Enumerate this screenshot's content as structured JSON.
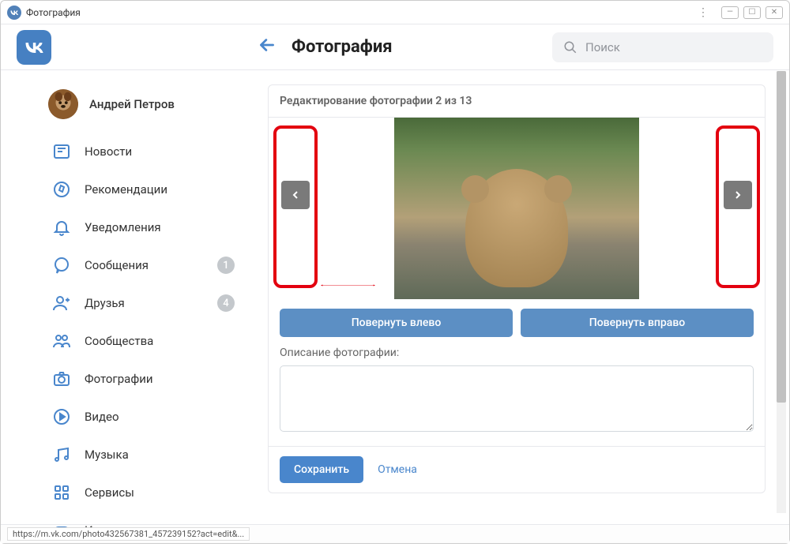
{
  "window": {
    "title": "Фотография"
  },
  "header": {
    "title": "Фотография",
    "search_placeholder": "Поиск"
  },
  "profile": {
    "name": "Андрей Петров"
  },
  "sidebar": {
    "items": [
      {
        "label": "Новости",
        "icon": "newspaper"
      },
      {
        "label": "Рекомендации",
        "icon": "compass"
      },
      {
        "label": "Уведомления",
        "icon": "bell"
      },
      {
        "label": "Сообщения",
        "icon": "chat",
        "badge": "1"
      },
      {
        "label": "Друзья",
        "icon": "user",
        "badge": "4"
      },
      {
        "label": "Сообщества",
        "icon": "users"
      },
      {
        "label": "Фотографии",
        "icon": "camera"
      },
      {
        "label": "Видео",
        "icon": "play"
      },
      {
        "label": "Музыка",
        "icon": "music"
      },
      {
        "label": "Сервисы",
        "icon": "grid"
      },
      {
        "label": "Игры",
        "icon": "gamepad"
      }
    ]
  },
  "editor": {
    "heading": "Редактирование фотографии 2 из 13",
    "rotate_left": "Повернуть влево",
    "rotate_right": "Повернуть вправо",
    "description_label": "Описание фотографии:",
    "description_value": "",
    "save": "Сохранить",
    "cancel": "Отмена"
  },
  "status": {
    "url": "https://m.vk.com/photo432567381_457239152?act=edit&..."
  }
}
